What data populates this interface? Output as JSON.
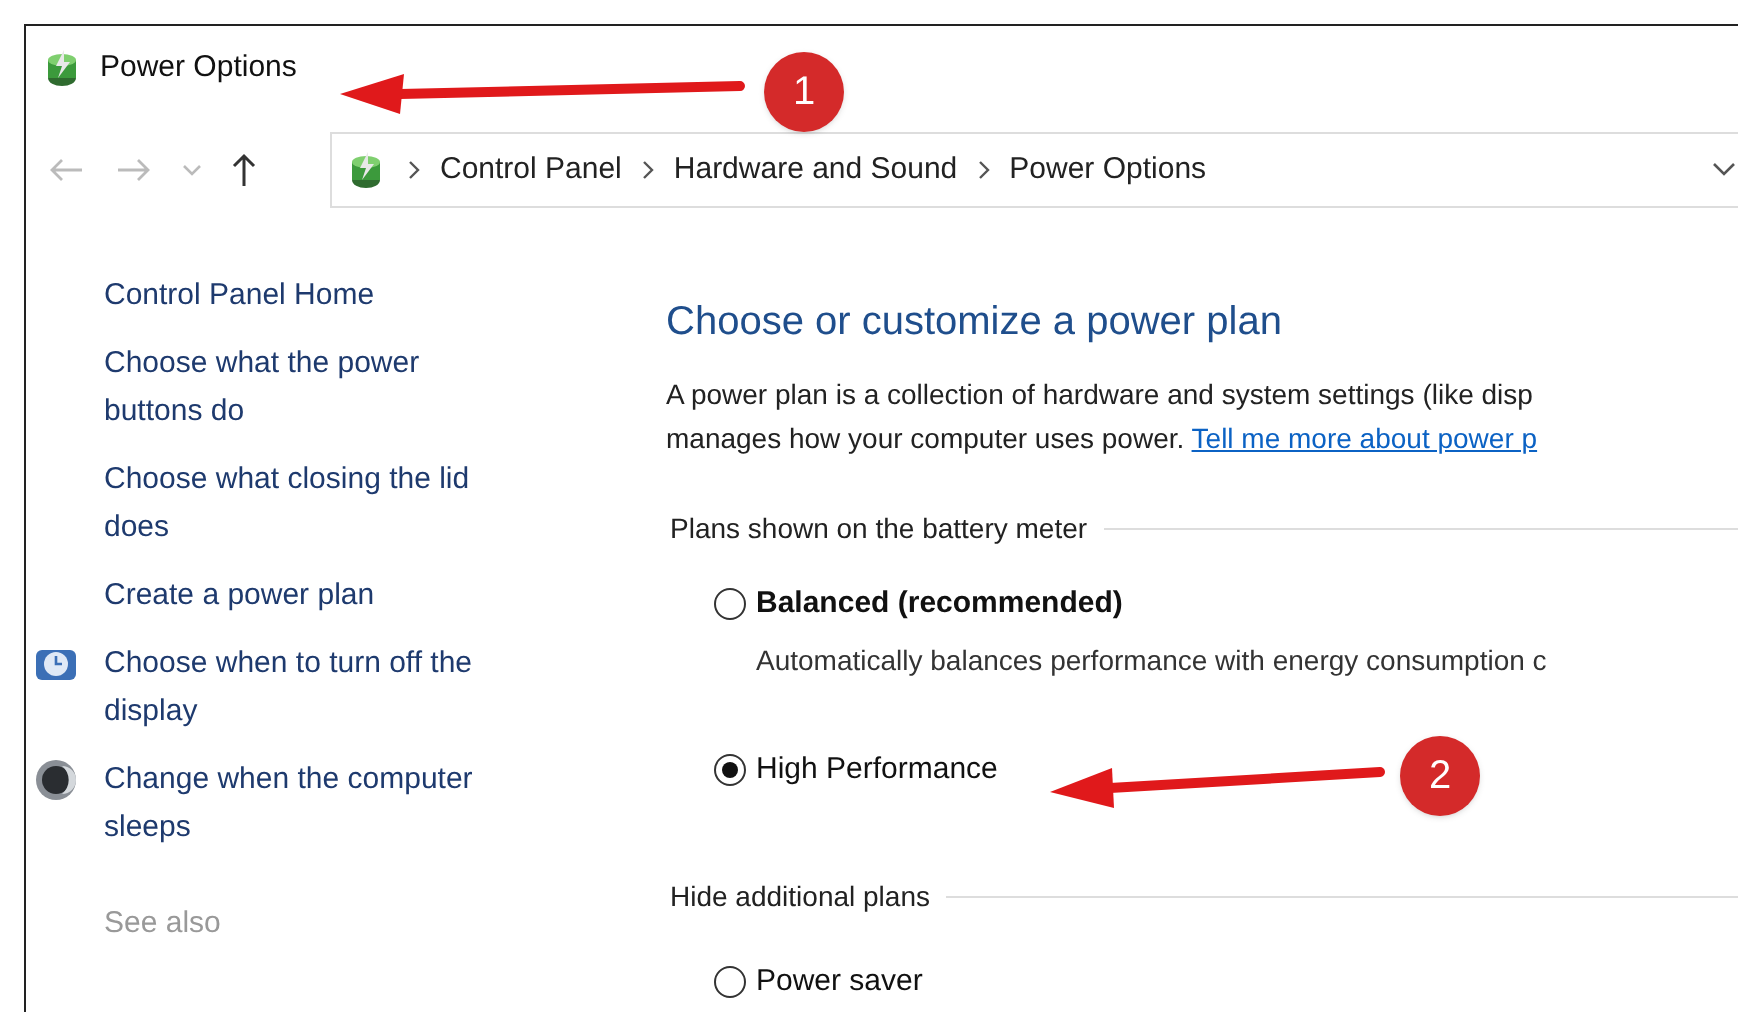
{
  "window": {
    "title": "Power Options"
  },
  "address_bar": {
    "crumbs": [
      "Control Panel",
      "Hardware and Sound",
      "Power Options"
    ]
  },
  "sidebar": {
    "items": [
      {
        "label": "Control Panel Home",
        "kind": "plain"
      },
      {
        "label": "Choose what the power buttons do",
        "kind": "plain"
      },
      {
        "label": "Choose what closing the lid does",
        "kind": "plain"
      },
      {
        "label": "Create a power plan",
        "kind": "plain"
      },
      {
        "label": "Choose when to turn off the display",
        "kind": "iconic"
      },
      {
        "label": "Change when the computer sleeps",
        "kind": "iconic"
      }
    ],
    "see_also": "See also"
  },
  "content": {
    "heading": "Choose or customize a power plan",
    "intro": "A power plan is a collection of hardware and system settings (like disp",
    "intro_line_2": "manages how your computer uses power.",
    "link": "Tell me more about power p",
    "sections": [
      {
        "title": "Plans shown on the battery meter",
        "plans": [
          {
            "label": "Balanced (recommended)",
            "bold": true,
            "selected": false,
            "description": "Automatically balances performance with energy consumption c"
          },
          {
            "label": "High Performance",
            "bold": false,
            "selected": true
          }
        ]
      },
      {
        "title": "Hide additional plans",
        "plans": [
          {
            "label": "Power saver",
            "bold": false,
            "selected": false
          }
        ]
      }
    ]
  },
  "annotations": [
    {
      "number": "1"
    },
    {
      "number": "2"
    }
  ]
}
